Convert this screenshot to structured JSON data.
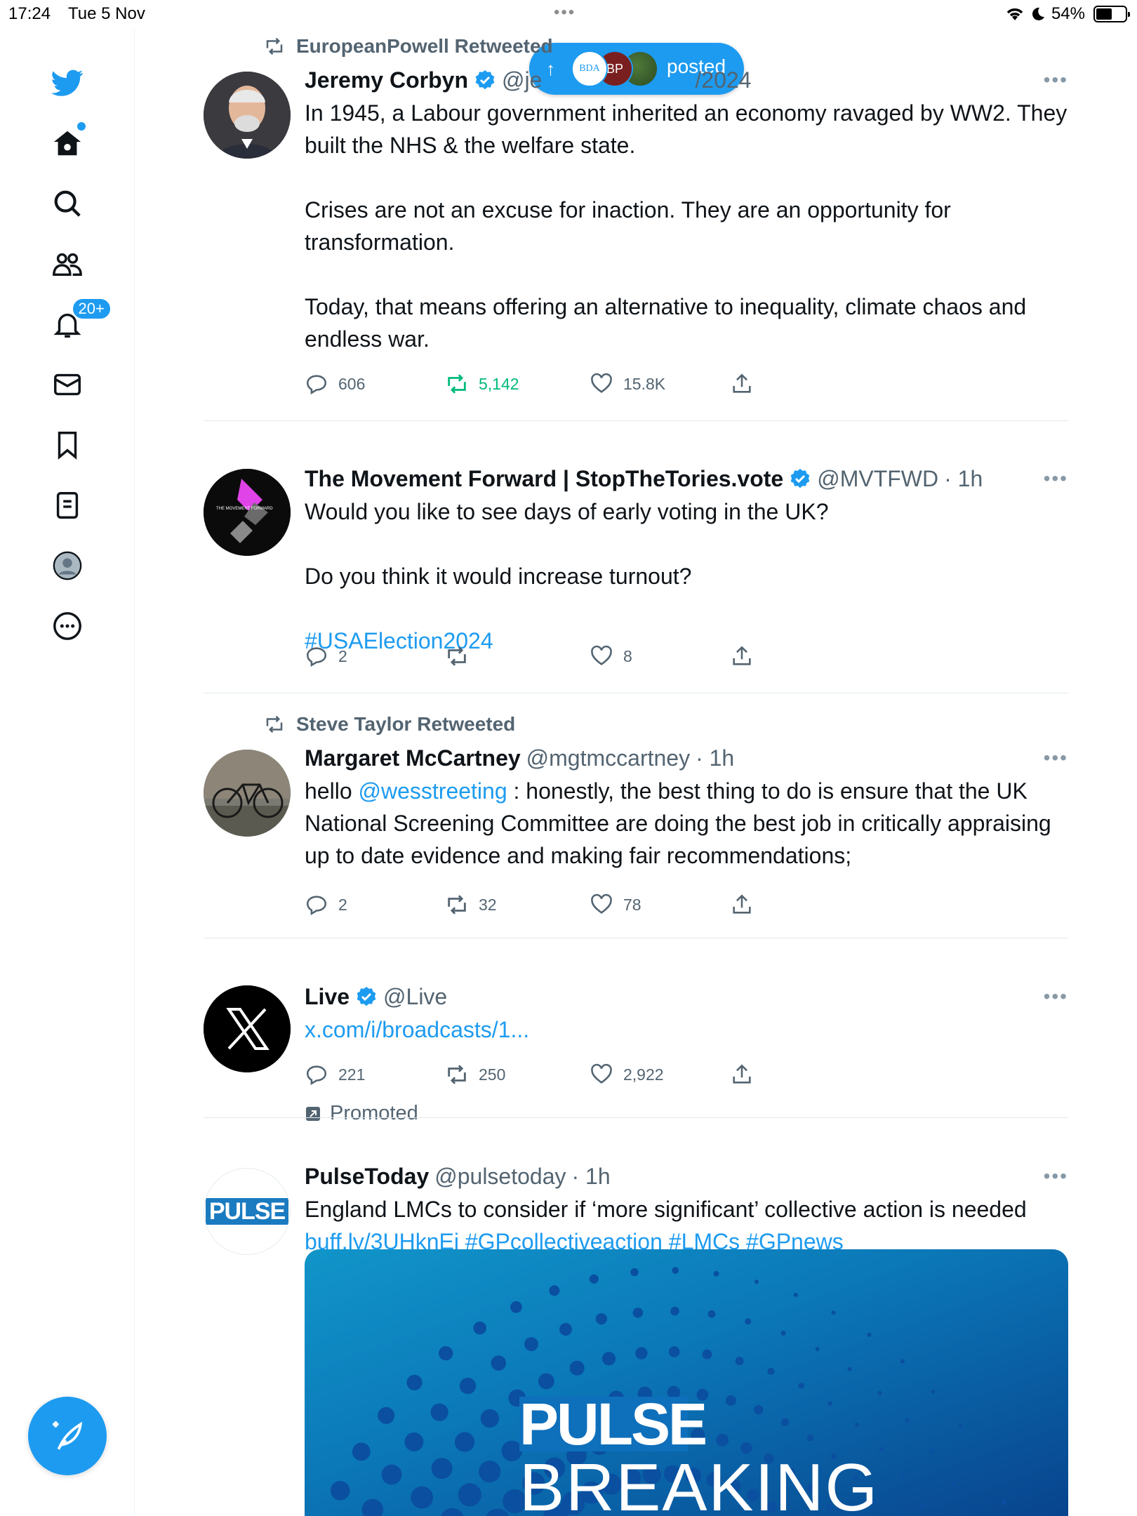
{
  "status_bar": {
    "time": "17:24",
    "date": "Tue 5 Nov",
    "battery": "54%",
    "battery_level": 0.54
  },
  "sidebar": {
    "items": [
      {
        "icon": "twitter-bird-icon"
      },
      {
        "icon": "home-icon"
      },
      {
        "icon": "search-icon"
      },
      {
        "icon": "communities-icon"
      },
      {
        "icon": "notifications-icon",
        "badge": "20+"
      },
      {
        "icon": "messages-icon"
      },
      {
        "icon": "bookmarks-icon"
      },
      {
        "icon": "lists-icon"
      },
      {
        "icon": "profile-icon"
      },
      {
        "icon": "more-icon"
      }
    ],
    "compose_icon": "compose-icon"
  },
  "posted_pill": {
    "label": "posted",
    "avatars": [
      "BDA",
      "BP",
      ""
    ]
  },
  "tweets": [
    {
      "retweeted_by": "EuropeanPowell Retweeted",
      "name": "Jeremy Corbyn",
      "verified": true,
      "handle": "@je",
      "time": "/2024",
      "text": "In 1945, a Labour government inherited an economy ravaged by WW2. They built the NHS & the welfare state.\n\nCrises are not an excuse for inaction. They are an opportunity for transformation.\n\nToday, that means offering an alternative to inequality, climate chaos and endless war.",
      "replies": "606",
      "retweets": "5,142",
      "likes": "15.8K"
    },
    {
      "name": "The Movement Forward | StopTheTories.vote",
      "verified": true,
      "handle": "@MVTFWD",
      "time": "· 1h",
      "text_1": "Would you like to see days of early voting in the UK?\n\nDo you think it would increase turnout?\n\n",
      "hashtag": "#USAElection2024",
      "replies": "2",
      "retweets": "",
      "likes": "8",
      "avatar_text": "THE MOVEMENT FORWARD"
    },
    {
      "retweeted_by": "Steve Taylor Retweeted",
      "name": "Margaret McCartney",
      "handle": "@mgtmccartney",
      "time": "· 1h",
      "text_pre": "hello ",
      "mention": "@wesstreeting",
      "text_post": " : honestly, the best thing to do is ensure that the UK National Screening Committee are doing the best job in critically appraising up to date evidence and making fair recommendations;",
      "replies": "2",
      "retweets": "32",
      "likes": "78"
    },
    {
      "name": "Live",
      "verified": true,
      "handle": "@Live",
      "link": "x.com/i/broadcasts/1...",
      "replies": "221",
      "retweets": "250",
      "likes": "2,922",
      "promoted": "Promoted"
    },
    {
      "name": "PulseToday",
      "handle": "@pulsetoday",
      "time": "· 1h",
      "text_pre": "England LMCs to consider if ‘more significant’ collective action is needed ",
      "link": "buff.ly/3UHknEj",
      "tags": "#GPcollectiveaction #LMCs #GPnews",
      "avatar_text": "PULSE",
      "card": {
        "title": "PULSE",
        "subtitle": "BREAKING"
      }
    }
  ],
  "more_label": "•••",
  "colors": {
    "accent": "#1d9bf0",
    "retweet_active": "#00ba7c",
    "muted": "#536471"
  }
}
